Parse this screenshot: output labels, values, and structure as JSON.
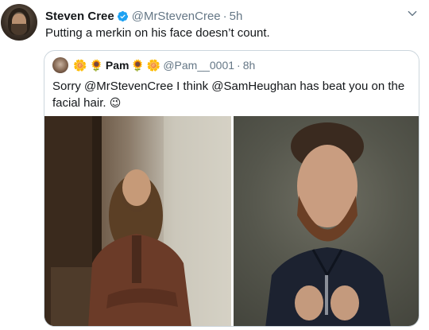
{
  "tweet": {
    "author_name": "Steven Cree",
    "author_handle": "@MrStevenCree",
    "separator": "·",
    "time": "5h",
    "text": "Putting a merkin on his face doesn’t count.",
    "avatar_icon": "profile-photo",
    "verified_icon": "verified-badge-icon",
    "menu_icon": "chevron-down-icon"
  },
  "quoted": {
    "name_prefix_emojis": [
      "🌼",
      "🌻"
    ],
    "author_name": "Pam",
    "name_suffix_emojis": [
      "🌻",
      "🌼"
    ],
    "author_handle": "@Pam__0001",
    "separator": "·",
    "time": "8h",
    "text": "Sorry @MrStevenCree I think @SamHeughan has beat you on  the facial hair.",
    "text_emoji": "😉",
    "media": [
      {
        "alt": "man with long hair and beard in leather jacket"
      },
      {
        "alt": "man with beard in dark jacket"
      }
    ]
  },
  "colors": {
    "text": "#14171a",
    "secondary": "#657786",
    "border": "#ccd6dd",
    "verified": "#1da1f2"
  }
}
